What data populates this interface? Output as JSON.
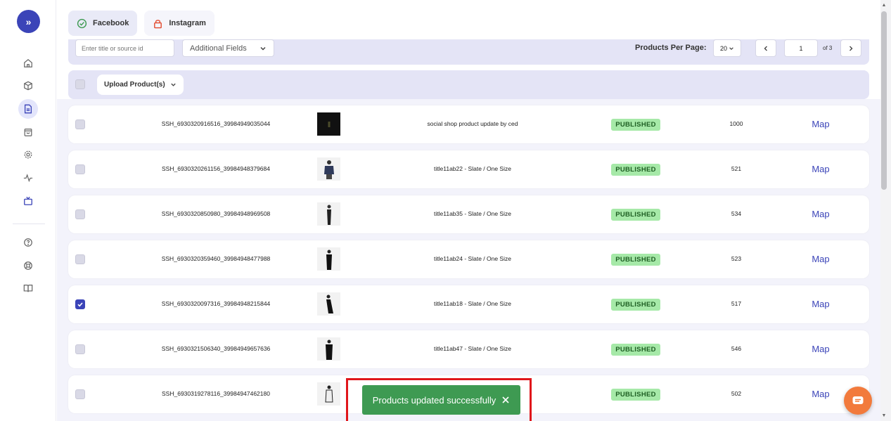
{
  "tabs": [
    {
      "label": "Facebook",
      "icon": "check-circle-icon",
      "active": true
    },
    {
      "label": "Instagram",
      "icon": "lock-icon",
      "active": false
    }
  ],
  "filters": {
    "search_placeholder": "Enter title or source id",
    "additional_fields_label": "Additional Fields",
    "products_per_page_label": "Products Per Page:",
    "per_page_value": "20",
    "page_value": "1",
    "page_of": "of 3"
  },
  "bulk": {
    "upload_label": "Upload Product(s)"
  },
  "rows": [
    {
      "sku": "SSH_6930320916516_39984949035044",
      "title": "social shop product update by ced",
      "status": "PUBLISHED",
      "qty": "1000",
      "map": "Map",
      "checked": false
    },
    {
      "sku": "SSH_6930320261156_39984948379684",
      "title": "title11ab22 - Slate / One Size",
      "status": "PUBLISHED",
      "qty": "521",
      "map": "Map",
      "checked": false
    },
    {
      "sku": "SSH_6930320850980_39984948969508",
      "title": "title11ab35 - Slate / One Size",
      "status": "PUBLISHED",
      "qty": "534",
      "map": "Map",
      "checked": false
    },
    {
      "sku": "SSH_6930320359460_39984948477988",
      "title": "title11ab24 - Slate / One Size",
      "status": "PUBLISHED",
      "qty": "523",
      "map": "Map",
      "checked": false
    },
    {
      "sku": "SSH_6930320097316_39984948215844",
      "title": "title11ab18 - Slate / One Size",
      "status": "PUBLISHED",
      "qty": "517",
      "map": "Map",
      "checked": true
    },
    {
      "sku": "SSH_6930321506340_39984949657636",
      "title": "title11ab47 - Slate / One Size",
      "status": "PUBLISHED",
      "qty": "546",
      "map": "Map",
      "checked": false
    },
    {
      "sku": "SSH_6930319278116_39984947462180",
      "title": "",
      "status": "PUBLISHED",
      "qty": "502",
      "map": "Map",
      "checked": false
    }
  ],
  "toast": {
    "message": "Products updated successfully"
  },
  "colors": {
    "accent": "#3b44b8",
    "status_bg": "#a6e9a8",
    "toast_bg": "#3e9a52",
    "highlight_border": "#e0161b",
    "chat_bg": "#f27a3c"
  }
}
